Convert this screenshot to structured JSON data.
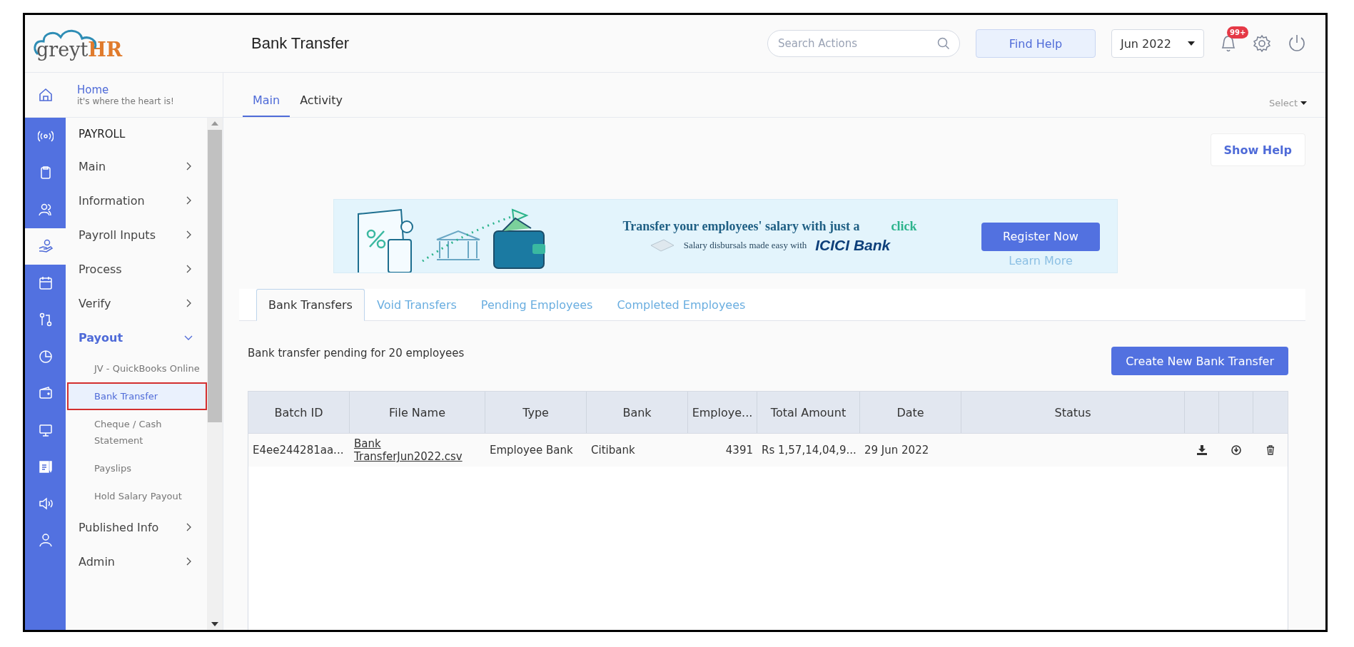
{
  "logo": {
    "text_main": "greyt",
    "text_accent": "HR"
  },
  "home": {
    "title": "Home",
    "subtitle": "it's where the heart is!"
  },
  "rail": [
    {
      "selected": false
    },
    {
      "selected": false
    },
    {
      "selected": false
    },
    {
      "selected": true
    },
    {
      "selected": false
    },
    {
      "selected": false
    },
    {
      "selected": false
    },
    {
      "selected": false
    },
    {
      "selected": false
    },
    {
      "selected": false
    },
    {
      "selected": false
    },
    {
      "selected": false
    }
  ],
  "sidebar": {
    "heading": "PAYROLL",
    "items": [
      {
        "label": "Main",
        "expanded": false
      },
      {
        "label": "Information",
        "expanded": false
      },
      {
        "label": "Payroll Inputs",
        "expanded": false
      },
      {
        "label": "Process",
        "expanded": false
      },
      {
        "label": "Verify",
        "expanded": false
      },
      {
        "label": "Payout",
        "expanded": true,
        "children": [
          {
            "label": "JV - QuickBooks Online",
            "selected": false
          },
          {
            "label": "Bank Transfer",
            "selected": true
          },
          {
            "label": "Cheque / Cash Statement",
            "selected": false
          },
          {
            "label": "Payslips",
            "selected": false
          },
          {
            "label": "Hold Salary Payout",
            "selected": false
          }
        ]
      },
      {
        "label": "Published Info",
        "expanded": false
      },
      {
        "label": "Admin",
        "expanded": false
      }
    ]
  },
  "header": {
    "title": "Bank Transfer",
    "search": {
      "placeholder": "Search Actions"
    },
    "find_help": "Find Help",
    "period": "Jun 2022",
    "notification_badge": "99+"
  },
  "main_tabs": [
    {
      "label": "Main",
      "selected": true
    },
    {
      "label": "Activity",
      "selected": false
    }
  ],
  "select_label": "Select",
  "show_help": "Show Help",
  "banner": {
    "headline": "Transfer your employees' salary with just a",
    "headline_accent": "click",
    "subline": "Salary disbursals made easy with",
    "bank_logo": "ICICI Bank",
    "register": "Register Now",
    "learn_more": "Learn More"
  },
  "sub_tabs": [
    {
      "label": "Bank Transfers",
      "selected": true
    },
    {
      "label": "Void Transfers",
      "selected": false
    },
    {
      "label": "Pending Employees",
      "selected": false
    },
    {
      "label": "Completed Employees",
      "selected": false
    }
  ],
  "pending_text": "Bank transfer pending for 20 employees",
  "create_button": "Create New Bank Transfer",
  "table": {
    "columns": [
      "Batch ID",
      "File Name",
      "Type",
      "Bank",
      "Employe...",
      "Total Amount",
      "Date",
      "Status"
    ],
    "rows": [
      {
        "batch_id": "E4ee244281aa...",
        "file_name": "Bank TransferJun2022.csv",
        "type": "Employee Bank",
        "bank": "Citibank",
        "employees": "4391",
        "total_amount": "Rs 1,57,14,04,9...",
        "date": "29 Jun 2022"
      }
    ]
  }
}
